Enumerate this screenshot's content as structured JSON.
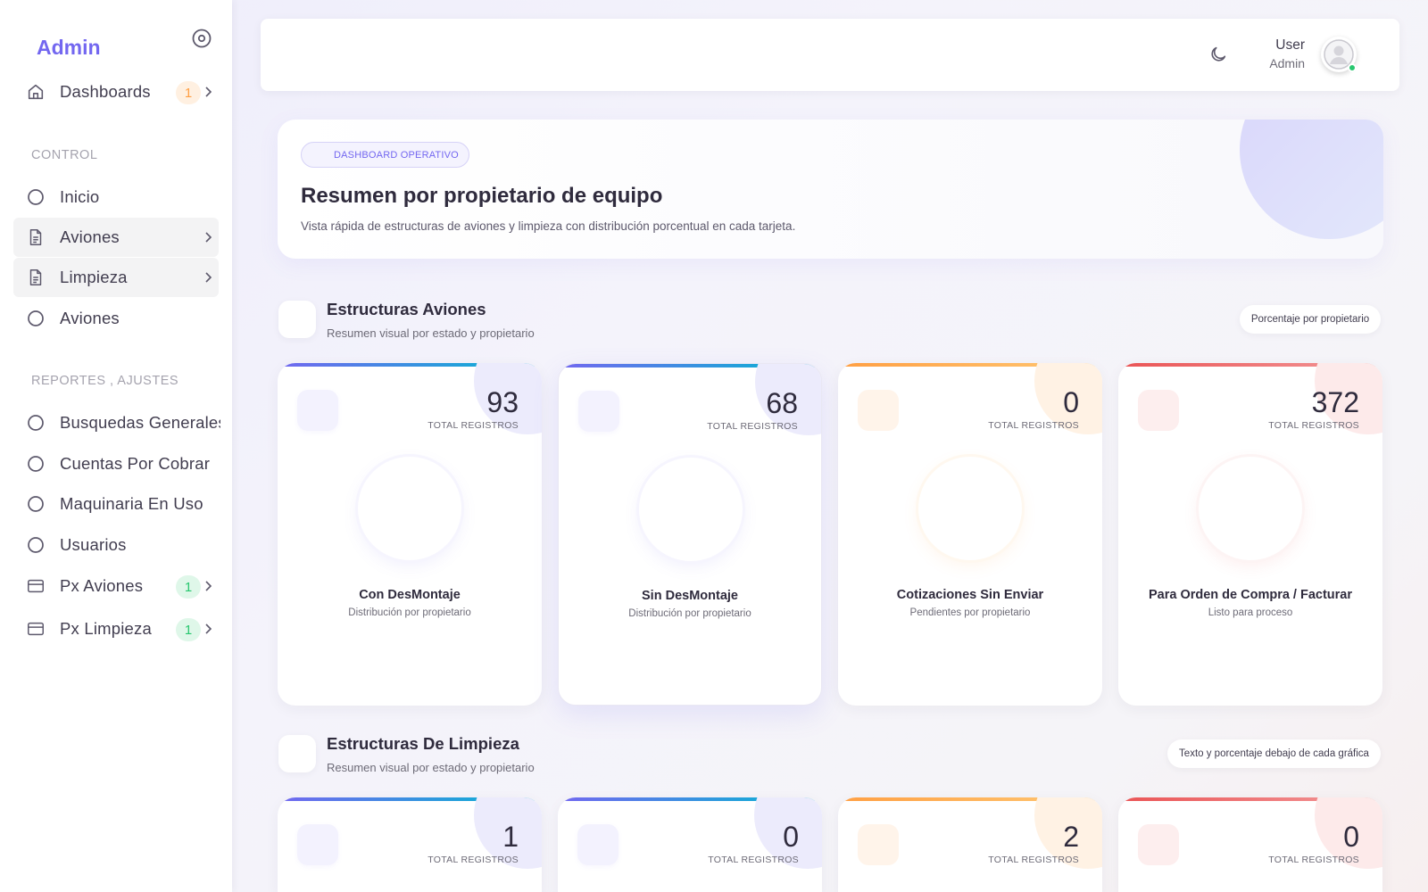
{
  "sidebar": {
    "brand": "Admin",
    "dashboards": {
      "label": "Dashboards",
      "badge": "1"
    },
    "section_control": "CONTROL",
    "control_items": [
      "Inicio",
      "Aviones",
      "Limpieza",
      "Aviones"
    ],
    "section_reports": "REPORTES , AJUSTES",
    "report_items": [
      "Busquedas Generales",
      "Cuentas Por Cobrar",
      "Maquinaria En Uso",
      "Usuarios"
    ],
    "px_aviones": {
      "label": "Px Aviones",
      "badge": "1"
    },
    "px_limpieza": {
      "label": "Px Limpieza",
      "badge": "1"
    }
  },
  "topbar": {
    "user_name": "User",
    "user_role": "Admin"
  },
  "hero": {
    "pill": "DASHBOARD OPERATIVO",
    "title": "Resumen por propietario de equipo",
    "subtitle": "Vista rápida de estructuras de aviones y limpieza con distribución porcentual en cada tarjeta."
  },
  "section_aviones": {
    "title": "Estructuras Aviones",
    "subtitle": "Resumen visual por estado y propietario",
    "chip": "Porcentaje por propietario",
    "total_label": "TOTAL REGISTROS",
    "cards": [
      {
        "value": "93",
        "title": "Con DesMontaje",
        "subtitle": "Distribución por propietario"
      },
      {
        "value": "68",
        "title": "Sin DesMontaje",
        "subtitle": "Distribución por propietario"
      },
      {
        "value": "0",
        "title": "Cotizaciones Sin Enviar",
        "subtitle": "Pendientes por propietario"
      },
      {
        "value": "372",
        "title": "Para Orden de Compra / Facturar",
        "subtitle": "Listo para proceso"
      }
    ]
  },
  "section_limpieza": {
    "title": "Estructuras De Limpieza",
    "subtitle": "Resumen visual por estado y propietario",
    "chip": "Texto y porcentaje debajo de cada gráfica",
    "total_label": "TOTAL REGISTROS",
    "cards": [
      {
        "value": "1"
      },
      {
        "value": "0"
      },
      {
        "value": "2"
      },
      {
        "value": "0"
      }
    ]
  },
  "colors": {
    "accent": "#7367f0",
    "orange": "#ff9f43",
    "red": "#ea5455",
    "green": "#28c76f"
  },
  "icons": [
    "target-icon",
    "home-icon",
    "circle-icon",
    "file-icon",
    "chevron-right-icon",
    "credit-card-icon",
    "moon-icon",
    "user-avatar-icon"
  ]
}
